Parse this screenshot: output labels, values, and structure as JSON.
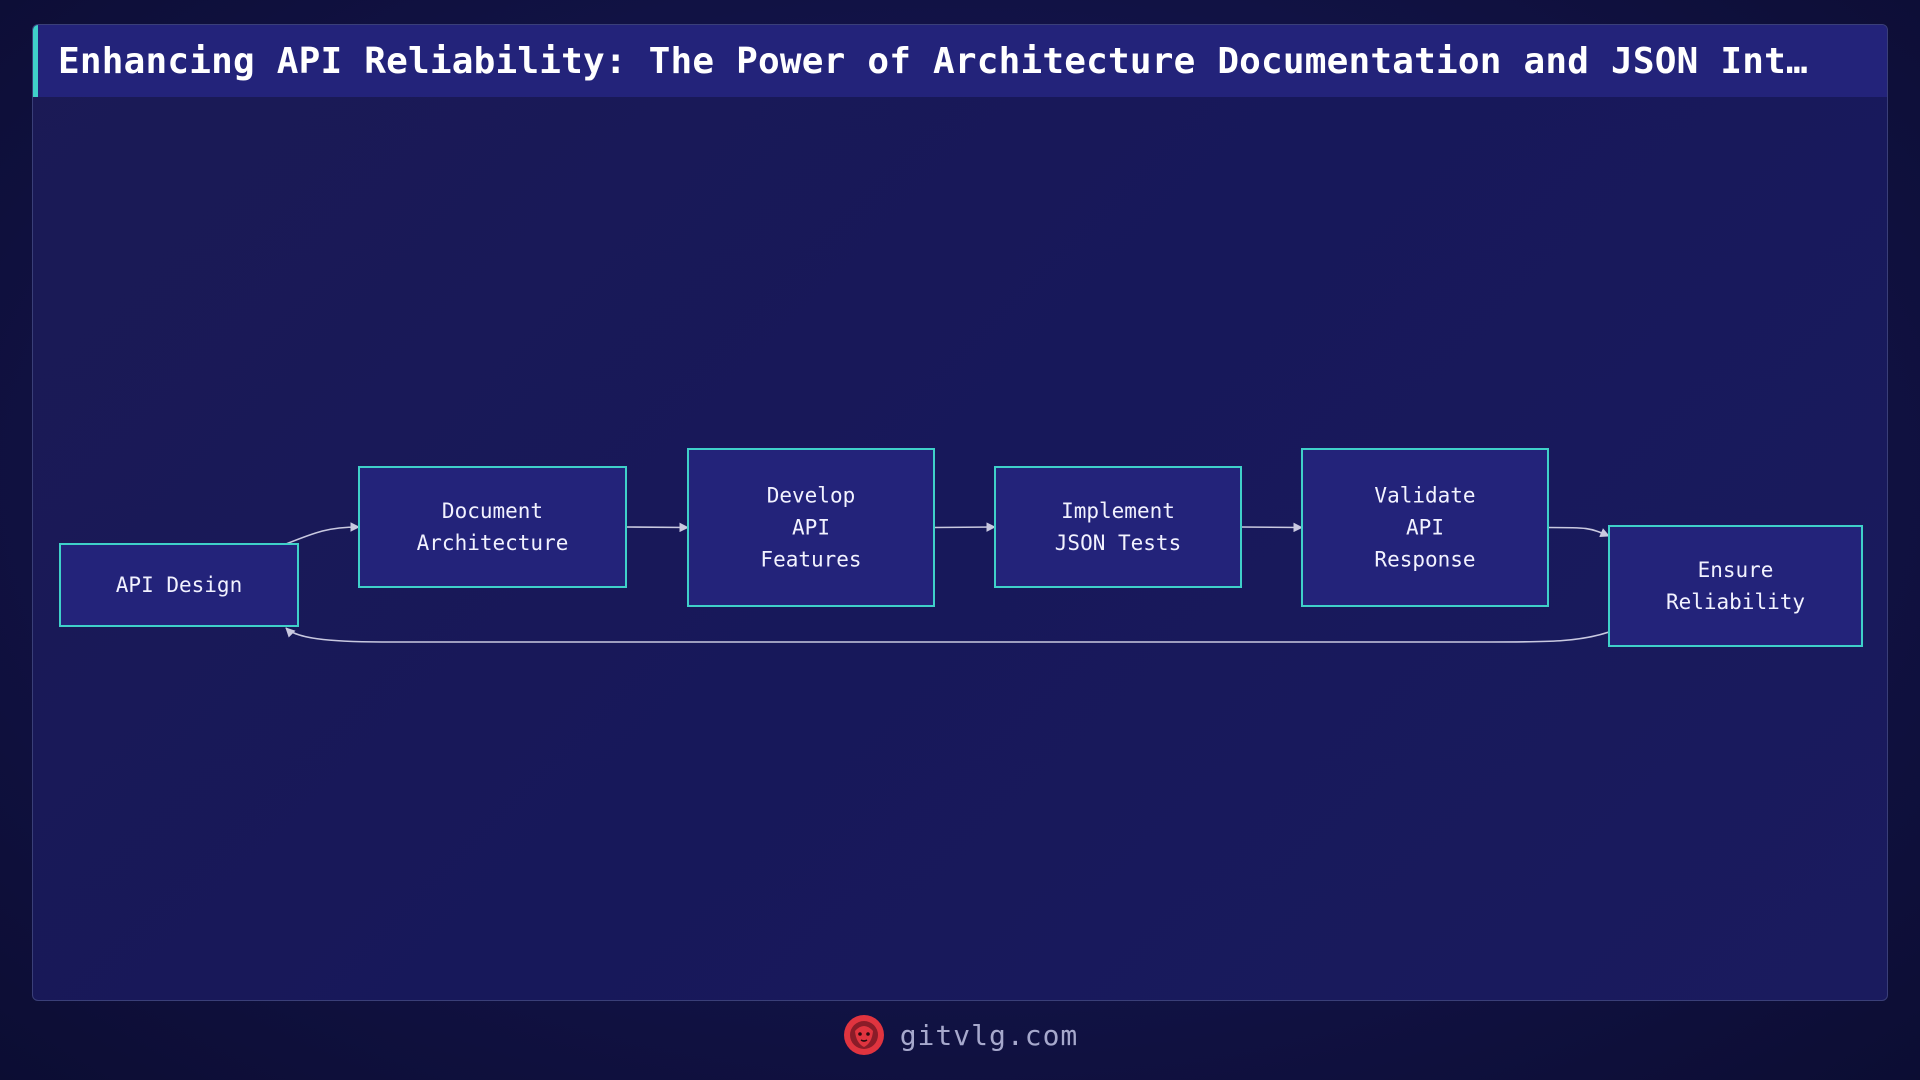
{
  "title": "Enhancing API Reliability: The Power of Architecture Documentation and JSON Int…",
  "footer": {
    "site": "gitvlg.com",
    "logo_icon": "lion-head-icon"
  },
  "colors": {
    "node_fill": "#23237a",
    "node_border": "#3fd0c9",
    "edge": "#c9c9e0",
    "accent": "#3fd0c9",
    "logo": "#e0343f"
  },
  "diagram": {
    "nodes": [
      {
        "id": "api-design",
        "lines": [
          "API Design"
        ]
      },
      {
        "id": "document-architecture",
        "lines": [
          "Document",
          "Architecture"
        ]
      },
      {
        "id": "develop-api-features",
        "lines": [
          "Develop",
          "API",
          "Features"
        ]
      },
      {
        "id": "implement-json-tests",
        "lines": [
          "Implement",
          "JSON Tests"
        ]
      },
      {
        "id": "validate-api-response",
        "lines": [
          "Validate",
          "API",
          "Response"
        ]
      },
      {
        "id": "ensure-reliability",
        "lines": [
          "Ensure",
          "Reliability"
        ]
      }
    ],
    "edges": [
      {
        "from": "api-design",
        "to": "document-architecture"
      },
      {
        "from": "document-architecture",
        "to": "develop-api-features"
      },
      {
        "from": "develop-api-features",
        "to": "implement-json-tests"
      },
      {
        "from": "implement-json-tests",
        "to": "validate-api-response"
      },
      {
        "from": "validate-api-response",
        "to": "ensure-reliability"
      },
      {
        "from": "ensure-reliability",
        "to": "api-design"
      }
    ]
  }
}
